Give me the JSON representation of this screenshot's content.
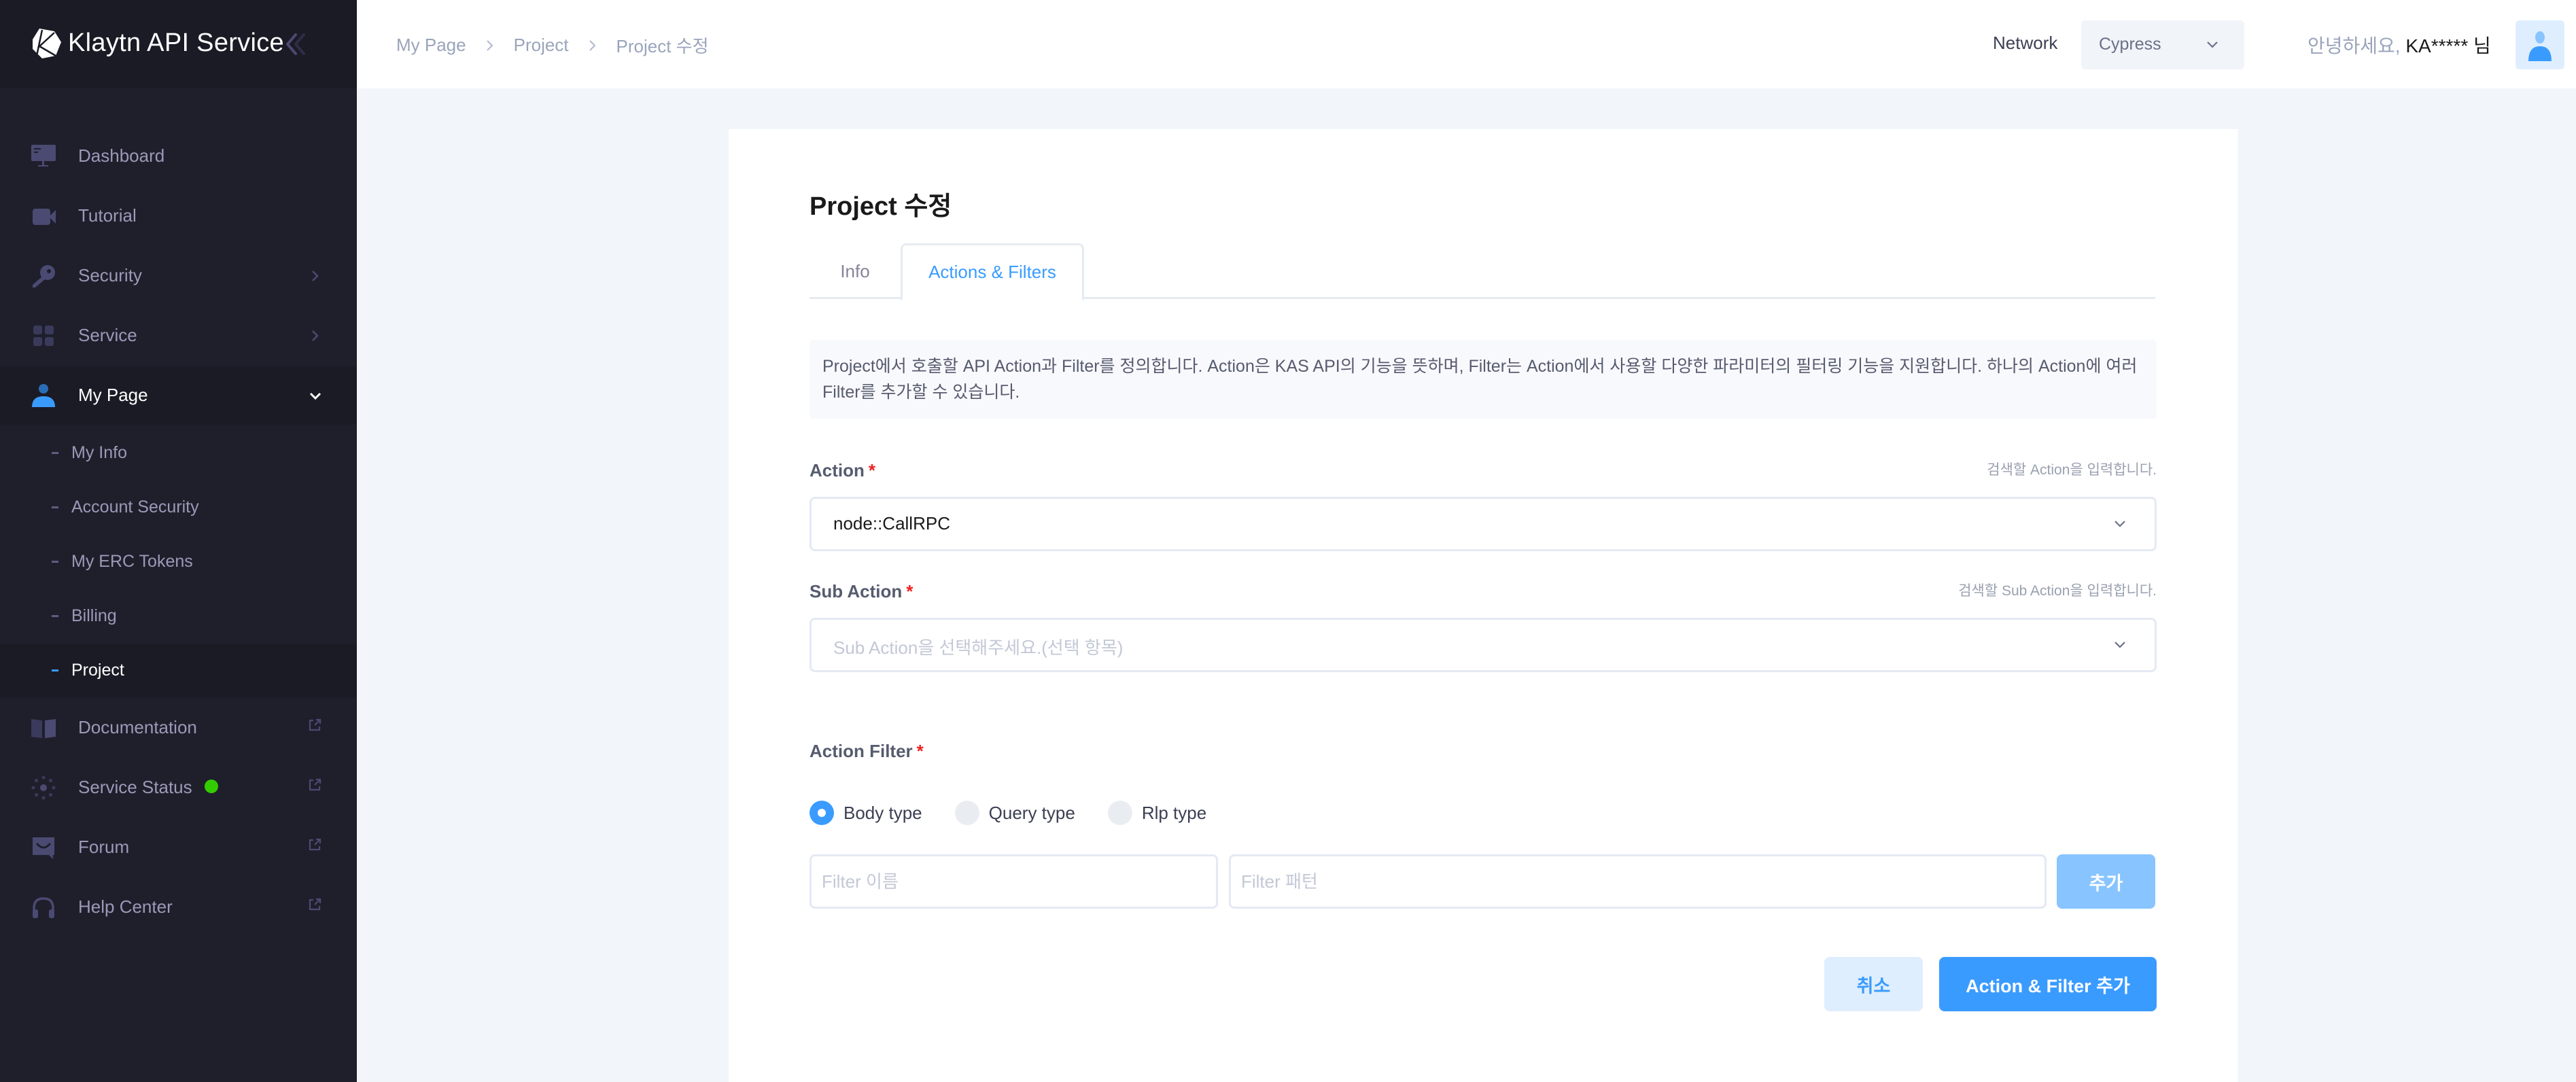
{
  "app": {
    "title": "Klaytn API Service"
  },
  "sidebar": {
    "items": [
      {
        "label": "Dashboard",
        "icon": "monitor-icon"
      },
      {
        "label": "Tutorial",
        "icon": "video-camera-icon"
      },
      {
        "label": "Security",
        "icon": "key-icon",
        "has_submenu": true
      },
      {
        "label": "Service",
        "icon": "grid-icon",
        "has_submenu": true
      },
      {
        "label": "My Page",
        "icon": "user-icon",
        "expanded": true,
        "active": true
      }
    ],
    "my_page_sub": [
      {
        "label": "My Info"
      },
      {
        "label": "Account Security"
      },
      {
        "label": "My ERC Tokens"
      },
      {
        "label": "Billing"
      },
      {
        "label": "Project",
        "active": true
      }
    ],
    "external_items": [
      {
        "label": "Documentation",
        "icon": "book-icon"
      },
      {
        "label": "Service Status",
        "icon": "sun-status-icon",
        "status_color": "#33cc00"
      },
      {
        "label": "Forum",
        "icon": "chat-bubble-icon"
      },
      {
        "label": "Help Center",
        "icon": "headphones-icon"
      }
    ]
  },
  "header": {
    "breadcrumb": [
      "My Page",
      "Project",
      "Project 수정"
    ],
    "network_label": "Network",
    "network_value": "Cypress",
    "greeting_prefix": "안녕하세요,",
    "username": "KA*****",
    "greeting_suffix": "님"
  },
  "main": {
    "title": "Project 수정",
    "tabs": [
      {
        "label": "Info",
        "active": false
      },
      {
        "label": "Actions & Filters",
        "active": true
      }
    ],
    "notice": "Project에서 호출할 API Action과 Filter를 정의합니다. Action은 KAS API의 기능을 뜻하며, Filter는 Action에서 사용할 다양한 파라미터의 필터링 기능을 지원합니다. 하나의 Action에 여러 Filter를 추가할 수 있습니다.",
    "action": {
      "label": "Action",
      "required_mark": "*",
      "hint": "검색할 Action을 입력합니다.",
      "value": "node::CallRPC"
    },
    "sub_action": {
      "label": "Sub Action",
      "required_mark": "*",
      "hint": "검색할 Sub Action을 입력합니다.",
      "placeholder": "Sub Action을 선택해주세요.(선택 항목)"
    },
    "action_filter": {
      "label": "Action Filter",
      "required_mark": "*",
      "types": [
        {
          "label": "Body type",
          "checked": true
        },
        {
          "label": "Query type",
          "checked": false
        },
        {
          "label": "Rlp type",
          "checked": false
        }
      ],
      "name_placeholder": "Filter 이름",
      "pattern_placeholder": "Filter 패턴",
      "add_label": "추가"
    },
    "buttons": {
      "cancel_label": "취소",
      "submit_label": "Action & Filter 추가"
    }
  },
  "colors": {
    "accent": "#3a9bff",
    "sidebar_bg": "#1f1f2c",
    "required": "#f01f1f",
    "status_ok": "#33cc00"
  }
}
